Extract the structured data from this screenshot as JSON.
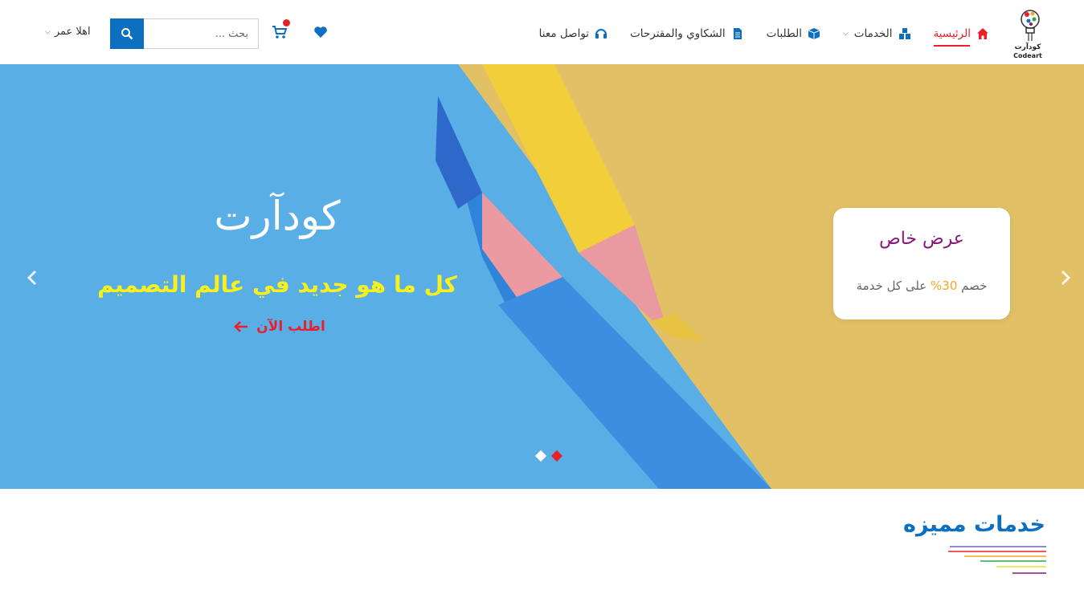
{
  "header": {
    "logo": {
      "ar_text": "كودآرت",
      "en_text": "Codeart"
    },
    "nav": [
      {
        "label": "الرئيسية",
        "icon": "home-icon",
        "active": true
      },
      {
        "label": "الخدمات",
        "icon": "services-icon",
        "dropdown": true
      },
      {
        "label": "الطلبات",
        "icon": "box-icon"
      },
      {
        "label": "الشكاوي والمقترحات",
        "icon": "document-icon"
      },
      {
        "label": "تواصل معنا",
        "icon": "headset-icon"
      }
    ],
    "search": {
      "placeholder": "بحث ..."
    },
    "user_menu": {
      "label": "اهلا عمر"
    },
    "colors": {
      "accent_blue": "#0d6fc0",
      "accent_red": "#e8202a"
    }
  },
  "hero": {
    "title": "كودآرت",
    "subtitle": "كل ما هو جديد في عالم التصميم",
    "cta": "اطلب الآن",
    "offer": {
      "title": "عرض خاص",
      "text_before": "خصم ",
      "percent": "30%",
      "text_after": " على كل خدمة"
    },
    "slides_total": 2,
    "active_slide": 2
  },
  "section": {
    "title": "خدمات مميزه"
  }
}
